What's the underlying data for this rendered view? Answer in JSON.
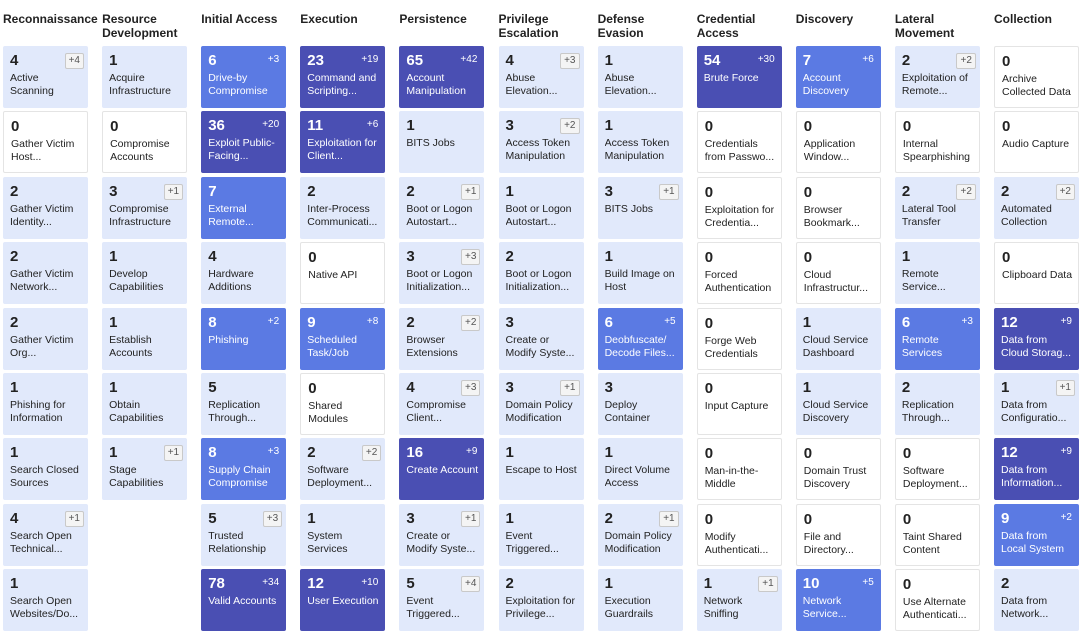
{
  "matrix": {
    "tactics": [
      {
        "name": "Reconnaissance",
        "techniques": [
          {
            "count": "4",
            "sub": "+4",
            "label": "Active Scanning",
            "level": 1
          },
          {
            "count": "0",
            "sub": "",
            "label": "Gather Victim Host...",
            "level": 0
          },
          {
            "count": "2",
            "sub": "",
            "label": "Gather Victim Identity...",
            "level": 1
          },
          {
            "count": "2",
            "sub": "",
            "label": "Gather Victim Network...",
            "level": 1
          },
          {
            "count": "2",
            "sub": "",
            "label": "Gather Victim Org...",
            "level": 1
          },
          {
            "count": "1",
            "sub": "",
            "label": "Phishing for Information",
            "level": 1
          },
          {
            "count": "1",
            "sub": "",
            "label": "Search Closed Sources",
            "level": 1
          },
          {
            "count": "4",
            "sub": "+1",
            "label": "Search Open Technical...",
            "level": 1
          },
          {
            "count": "1",
            "sub": "",
            "label": "Search Open Websites/Do...",
            "level": 1
          }
        ]
      },
      {
        "name": "Resource Development",
        "techniques": [
          {
            "count": "1",
            "sub": "",
            "label": "Acquire Infrastructure",
            "level": 1
          },
          {
            "count": "0",
            "sub": "",
            "label": "Compromise Accounts",
            "level": 0
          },
          {
            "count": "3",
            "sub": "+1",
            "label": "Compromise Infrastructure",
            "level": 1
          },
          {
            "count": "1",
            "sub": "",
            "label": "Develop Capabilities",
            "level": 1
          },
          {
            "count": "1",
            "sub": "",
            "label": "Establish Accounts",
            "level": 1
          },
          {
            "count": "1",
            "sub": "",
            "label": "Obtain Capabilities",
            "level": 1
          },
          {
            "count": "1",
            "sub": "+1",
            "label": "Stage Capabilities",
            "level": 1
          }
        ]
      },
      {
        "name": "Initial Access",
        "techniques": [
          {
            "count": "6",
            "sub": "+3",
            "label": "Drive-by Compromise",
            "level": 2
          },
          {
            "count": "36",
            "sub": "+20",
            "label": "Exploit Public-Facing...",
            "level": 3
          },
          {
            "count": "7",
            "sub": "",
            "label": "External Remote...",
            "level": 2
          },
          {
            "count": "4",
            "sub": "",
            "label": "Hardware Additions",
            "level": 1
          },
          {
            "count": "8",
            "sub": "+2",
            "label": "Phishing",
            "level": 2
          },
          {
            "count": "5",
            "sub": "",
            "label": "Replication Through...",
            "level": 1
          },
          {
            "count": "8",
            "sub": "+3",
            "label": "Supply Chain Compromise",
            "level": 2
          },
          {
            "count": "5",
            "sub": "+3",
            "label": "Trusted Relationship",
            "level": 1
          },
          {
            "count": "78",
            "sub": "+34",
            "label": "Valid Accounts",
            "level": 3
          }
        ]
      },
      {
        "name": "Execution",
        "techniques": [
          {
            "count": "23",
            "sub": "+19",
            "label": "Command and Scripting...",
            "level": 3
          },
          {
            "count": "11",
            "sub": "+6",
            "label": "Exploitation for Client...",
            "level": 3
          },
          {
            "count": "2",
            "sub": "",
            "label": "Inter-Process Communicati...",
            "level": 1
          },
          {
            "count": "0",
            "sub": "",
            "label": "Native API",
            "level": 0
          },
          {
            "count": "9",
            "sub": "+8",
            "label": "Scheduled Task/Job",
            "level": 2
          },
          {
            "count": "0",
            "sub": "",
            "label": "Shared Modules",
            "level": 0
          },
          {
            "count": "2",
            "sub": "+2",
            "label": "Software Deployment...",
            "level": 1
          },
          {
            "count": "1",
            "sub": "",
            "label": "System Services",
            "level": 1
          },
          {
            "count": "12",
            "sub": "+10",
            "label": "User Execution",
            "level": 3
          }
        ]
      },
      {
        "name": "Persistence",
        "techniques": [
          {
            "count": "65",
            "sub": "+42",
            "label": "Account Manipulation",
            "level": 3
          },
          {
            "count": "1",
            "sub": "",
            "label": "BITS Jobs",
            "level": 1
          },
          {
            "count": "2",
            "sub": "+1",
            "label": "Boot or Logon Autostart...",
            "level": 1
          },
          {
            "count": "3",
            "sub": "+3",
            "label": "Boot or Logon Initialization...",
            "level": 1
          },
          {
            "count": "2",
            "sub": "+2",
            "label": "Browser Extensions",
            "level": 1
          },
          {
            "count": "4",
            "sub": "+3",
            "label": "Compromise Client...",
            "level": 1
          },
          {
            "count": "16",
            "sub": "+9",
            "label": "Create Account",
            "level": 3
          },
          {
            "count": "3",
            "sub": "+1",
            "label": "Create or Modify Syste...",
            "level": 1
          },
          {
            "count": "5",
            "sub": "+4",
            "label": "Event Triggered...",
            "level": 1
          }
        ]
      },
      {
        "name": "Privilege Escalation",
        "techniques": [
          {
            "count": "4",
            "sub": "+3",
            "label": "Abuse Elevation...",
            "level": 1
          },
          {
            "count": "3",
            "sub": "+2",
            "label": "Access Token Manipulation",
            "level": 1
          },
          {
            "count": "1",
            "sub": "",
            "label": "Boot or Logon Autostart...",
            "level": 1
          },
          {
            "count": "2",
            "sub": "",
            "label": "Boot or Logon Initialization...",
            "level": 1
          },
          {
            "count": "3",
            "sub": "",
            "label": "Create or Modify Syste...",
            "level": 1
          },
          {
            "count": "3",
            "sub": "+1",
            "label": "Domain Policy Modification",
            "level": 1
          },
          {
            "count": "1",
            "sub": "",
            "label": "Escape to Host",
            "level": 1
          },
          {
            "count": "1",
            "sub": "",
            "label": "Event Triggered...",
            "level": 1
          },
          {
            "count": "2",
            "sub": "",
            "label": "Exploitation for Privilege...",
            "level": 1
          }
        ]
      },
      {
        "name": "Defense Evasion",
        "techniques": [
          {
            "count": "1",
            "sub": "",
            "label": "Abuse Elevation...",
            "level": 1
          },
          {
            "count": "1",
            "sub": "",
            "label": "Access Token Manipulation",
            "level": 1
          },
          {
            "count": "3",
            "sub": "+1",
            "label": "BITS Jobs",
            "level": 1
          },
          {
            "count": "1",
            "sub": "",
            "label": "Build Image on Host",
            "level": 1
          },
          {
            "count": "6",
            "sub": "+5",
            "label": "Deobfuscate/ Decode Files...",
            "level": 2
          },
          {
            "count": "3",
            "sub": "",
            "label": "Deploy Container",
            "level": 1
          },
          {
            "count": "1",
            "sub": "",
            "label": "Direct Volume Access",
            "level": 1
          },
          {
            "count": "2",
            "sub": "+1",
            "label": "Domain Policy Modification",
            "level": 1
          },
          {
            "count": "1",
            "sub": "",
            "label": "Execution Guardrails",
            "level": 1
          }
        ]
      },
      {
        "name": "Credential Access",
        "techniques": [
          {
            "count": "54",
            "sub": "+30",
            "label": "Brute Force",
            "level": 3
          },
          {
            "count": "0",
            "sub": "",
            "label": "Credentials from Passwo...",
            "level": 0
          },
          {
            "count": "0",
            "sub": "",
            "label": "Exploitation for Credentia...",
            "level": 0
          },
          {
            "count": "0",
            "sub": "",
            "label": "Forced Authentication",
            "level": 0
          },
          {
            "count": "0",
            "sub": "",
            "label": "Forge Web Credentials",
            "level": 0
          },
          {
            "count": "0",
            "sub": "",
            "label": "Input Capture",
            "level": 0
          },
          {
            "count": "0",
            "sub": "",
            "label": "Man-in-the-Middle",
            "level": 0
          },
          {
            "count": "0",
            "sub": "",
            "label": "Modify Authenticati...",
            "level": 0
          },
          {
            "count": "1",
            "sub": "+1",
            "label": "Network Sniffing",
            "level": 1
          }
        ]
      },
      {
        "name": "Discovery",
        "techniques": [
          {
            "count": "7",
            "sub": "+6",
            "label": "Account Discovery",
            "level": 2
          },
          {
            "count": "0",
            "sub": "",
            "label": "Application Window...",
            "level": 0
          },
          {
            "count": "0",
            "sub": "",
            "label": "Browser Bookmark...",
            "level": 0
          },
          {
            "count": "0",
            "sub": "",
            "label": "Cloud Infrastructur...",
            "level": 0
          },
          {
            "count": "1",
            "sub": "",
            "label": "Cloud Service Dashboard",
            "level": 1
          },
          {
            "count": "1",
            "sub": "",
            "label": "Cloud Service Discovery",
            "level": 1
          },
          {
            "count": "0",
            "sub": "",
            "label": "Domain Trust Discovery",
            "level": 0
          },
          {
            "count": "0",
            "sub": "",
            "label": "File and Directory...",
            "level": 0
          },
          {
            "count": "10",
            "sub": "+5",
            "label": "Network Service...",
            "level": 2
          }
        ]
      },
      {
        "name": "Lateral Movement",
        "techniques": [
          {
            "count": "2",
            "sub": "+2",
            "label": "Exploitation of Remote...",
            "level": 1
          },
          {
            "count": "0",
            "sub": "",
            "label": "Internal Spearphishing",
            "level": 0
          },
          {
            "count": "2",
            "sub": "+2",
            "label": "Lateral Tool Transfer",
            "level": 1
          },
          {
            "count": "1",
            "sub": "",
            "label": "Remote Service...",
            "level": 1
          },
          {
            "count": "6",
            "sub": "+3",
            "label": "Remote Services",
            "level": 2
          },
          {
            "count": "2",
            "sub": "",
            "label": "Replication Through...",
            "level": 1
          },
          {
            "count": "0",
            "sub": "",
            "label": "Software Deployment...",
            "level": 0
          },
          {
            "count": "0",
            "sub": "",
            "label": "Taint Shared Content",
            "level": 0
          },
          {
            "count": "0",
            "sub": "",
            "label": "Use Alternate Authenticati...",
            "level": 0
          }
        ]
      },
      {
        "name": "Collection",
        "techniques": [
          {
            "count": "0",
            "sub": "",
            "label": "Archive Collected Data",
            "level": 0
          },
          {
            "count": "0",
            "sub": "",
            "label": "Audio Capture",
            "level": 0
          },
          {
            "count": "2",
            "sub": "+2",
            "label": "Automated Collection",
            "level": 1
          },
          {
            "count": "0",
            "sub": "",
            "label": "Clipboard Data",
            "level": 0
          },
          {
            "count": "12",
            "sub": "+9",
            "label": "Data from Cloud Storag...",
            "level": 3
          },
          {
            "count": "1",
            "sub": "+1",
            "label": "Data from Configuratio...",
            "level": 1
          },
          {
            "count": "12",
            "sub": "+9",
            "label": "Data from Information...",
            "level": 3
          },
          {
            "count": "9",
            "sub": "+2",
            "label": "Data from Local System",
            "level": 2
          },
          {
            "count": "2",
            "sub": "",
            "label": "Data from Network...",
            "level": 1
          }
        ]
      }
    ]
  }
}
